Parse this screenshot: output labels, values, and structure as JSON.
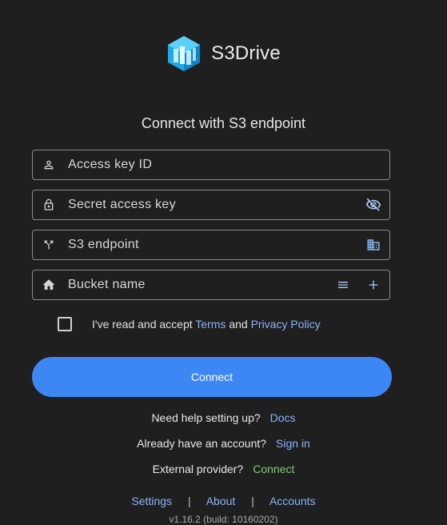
{
  "app": {
    "name": "S3Drive"
  },
  "heading": "Connect with S3 endpoint",
  "fields": {
    "access_key": {
      "placeholder": "Access key ID",
      "icon": "person-icon"
    },
    "secret_key": {
      "placeholder": "Secret access key",
      "icon": "lock-icon",
      "trailing_icon": "visibility-off-icon"
    },
    "endpoint": {
      "placeholder": "S3 endpoint",
      "icon": "fork-icon",
      "trailing_icon": "domain-icon"
    },
    "bucket": {
      "placeholder": "Bucket name",
      "icon": "home-icon",
      "trailing_icons": [
        "list-icon",
        "plus-icon"
      ]
    }
  },
  "agreement": {
    "checked": false,
    "prefix": "I've read and accept",
    "terms": "Terms",
    "and": "and",
    "privacy": "Privacy Policy"
  },
  "connect_button": "Connect",
  "help": {
    "text": "Need help setting up?",
    "link": "Docs"
  },
  "account": {
    "text": "Already have an account?",
    "link": "Sign in"
  },
  "external": {
    "text": "External provider?",
    "link": "Connect"
  },
  "footer": {
    "links": [
      "Settings",
      "About",
      "Accounts"
    ],
    "separator": "|",
    "version": "v1.16.2 (build: 10160202)"
  },
  "colors": {
    "background": "#1f1f1f",
    "accent": "#3d87f5",
    "link": "#8ab4f8",
    "green_link": "#7ccf6f"
  }
}
